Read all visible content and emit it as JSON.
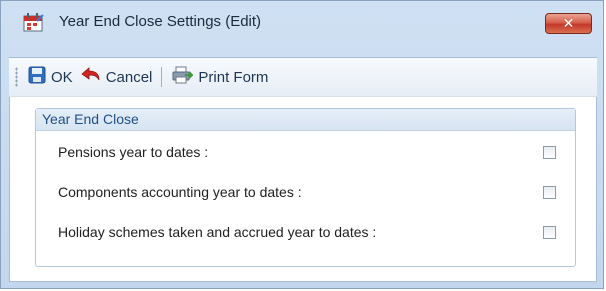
{
  "window": {
    "title": "Year End Close Settings (Edit)",
    "close_glyph": "✕",
    "app_icon": "calendar-report-icon"
  },
  "toolbar": {
    "ok_label": "OK",
    "cancel_label": "Cancel",
    "print_label": "Print Form",
    "icons": {
      "ok": "save-icon",
      "cancel": "undo-arrow-icon",
      "print": "print-form-icon"
    }
  },
  "group": {
    "title": "Year End Close",
    "rows": [
      {
        "label": "Pensions year to dates :",
        "checked": false
      },
      {
        "label": "Components accounting year to dates :",
        "checked": false
      },
      {
        "label": "Holiday schemes taken and accrued year to dates :",
        "checked": false
      }
    ]
  },
  "colors": {
    "frame": "#c2d7ee",
    "close": "#c4372a",
    "group_header_text": "#1f4e86"
  }
}
